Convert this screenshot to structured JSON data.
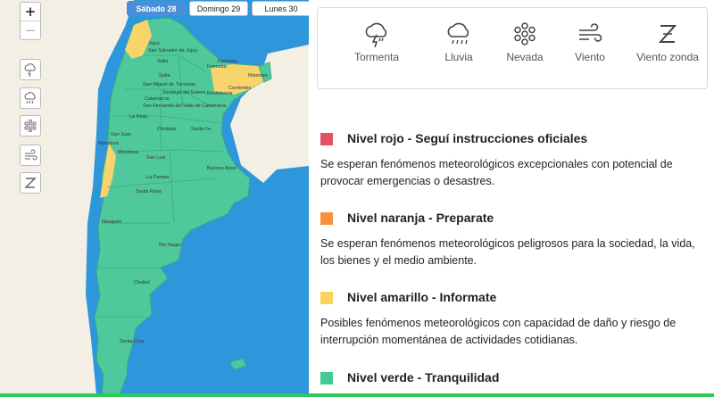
{
  "map": {
    "zoom_in": "+",
    "zoom_out": "−",
    "days": [
      {
        "label": "Sábado 28",
        "active": true
      },
      {
        "label": "Domingo 29",
        "active": false
      },
      {
        "label": "Lunes 30",
        "active": false
      }
    ],
    "place_labels": [
      "Jujuy",
      "San Salvador de Jujuy",
      "Salta",
      "Formosa",
      "Formosa",
      "Misiones",
      "Salta",
      "San Miguel de Tucumán",
      "Corrientes",
      "Resistencia",
      "Santiago del Estero",
      "Catamarca",
      "San Fernando del Valle de Catamarca",
      "La Rioja",
      "Santa Fe",
      "San Juan",
      "Córdoba",
      "Mendoza",
      "Mendoza",
      "San Luis",
      "Buenos Aires",
      "La Pampa",
      "Santa Rosa",
      "Neuquén",
      "Río Negro",
      "Chubut",
      "Santa Cruz"
    ],
    "colors": {
      "sea": "#2e97db",
      "green": "#4fc99b",
      "yellow": "#f7d46c",
      "neighbor": "#f3efe4"
    }
  },
  "phenomena": [
    {
      "label": "Tormenta",
      "icon": "storm-icon"
    },
    {
      "label": "Lluvia",
      "icon": "rain-icon"
    },
    {
      "label": "Nevada",
      "icon": "snow-icon"
    },
    {
      "label": "Viento",
      "icon": "wind-icon"
    },
    {
      "label": "Viento zonda",
      "icon": "zonda-icon"
    }
  ],
  "levels": [
    {
      "title": "Nivel rojo - Seguí instrucciones oficiales",
      "color": "#e05262",
      "description": "Se esperan fenómenos meteorológicos excepcionales con potencial de provocar emergencias o desastres."
    },
    {
      "title": "Nivel naranja - Preparate",
      "color": "#f6913e",
      "description": "Se esperan fenómenos meteorológicos peligrosos para la sociedad, la vida, los bienes y el medio ambiente."
    },
    {
      "title": "Nivel amarillo - Informate",
      "color": "#fbd35b",
      "description": "Posibles fenómenos meteorológicos con capacidad de daño y riesgo de interrupción momentánea de actividades cotidianas."
    },
    {
      "title": "Nivel verde - Tranquilidad",
      "color": "#3fcb94",
      "description": ""
    }
  ]
}
